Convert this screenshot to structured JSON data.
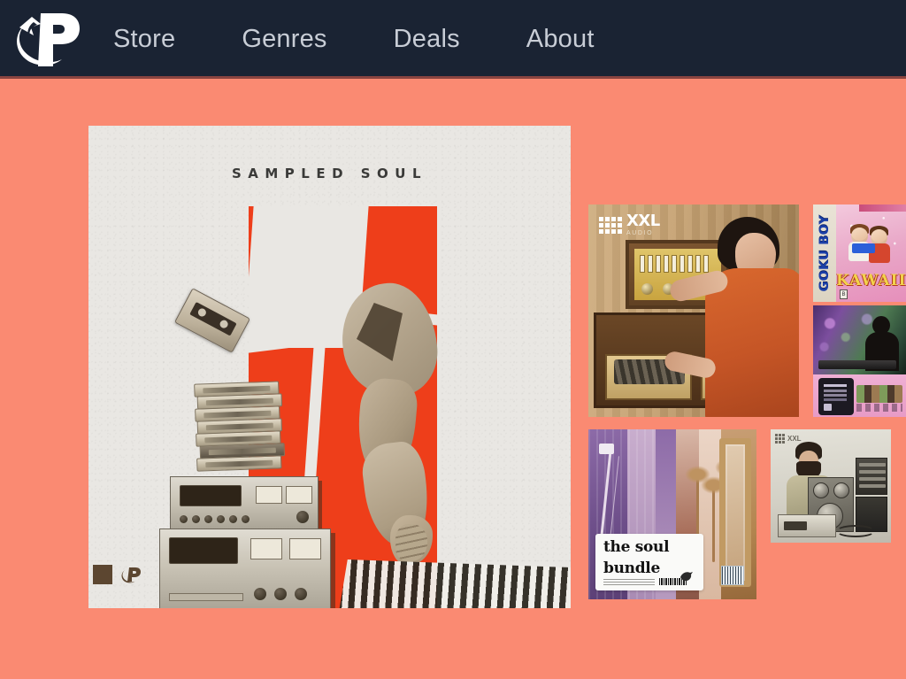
{
  "header": {
    "logo": {
      "icon": "swoosh-p-logo",
      "alt": "P"
    },
    "nav_items": [
      {
        "label": "Store"
      },
      {
        "label": "Genres"
      },
      {
        "label": "Deals"
      },
      {
        "label": "About"
      }
    ]
  },
  "hero": {
    "title": "SAMPLED SOUL",
    "footer_mark_icon": "swoosh-p-mark",
    "artwork_elements": [
      "red-fractured-panel",
      "sculpted-figure-holding-cassette",
      "stacked-cassette-tapes",
      "vintage-stereo-receiver",
      "vintage-cassette-deck",
      "striped-rug"
    ]
  },
  "gallery": {
    "items": [
      {
        "id": "xxl-audio",
        "name": "xxl-audio-ad",
        "brand": "XXL",
        "brand_sub": "AUDIO",
        "description": "Vintage hi-fi advertisement with woman and turntable console"
      },
      {
        "id": "goku-boy",
        "name": "goku-boy-cartridge",
        "spine_label": "GOKU BOY",
        "title": "KAWAII",
        "rating": "B",
        "description": "Handheld game cartridge box with two anime characters"
      },
      {
        "id": "synth-session",
        "name": "synth-session-photo",
        "description": "Silhouetted musician at keyboard with bokeh lights"
      },
      {
        "id": "soul-bundle",
        "name": "soul-bundle-cover",
        "title_line_1": "the soul",
        "title_line_2": "bundle",
        "description": "Purple and peach collage with palm trees and gilded frame"
      },
      {
        "id": "home-studio",
        "name": "home-studio-photo",
        "description": "Bearded man seated beside speakers, rack gear and tape deck"
      }
    ]
  },
  "theme": {
    "background": "#FA8A72",
    "header_bg": "#1A2333",
    "nav_text": "#C8CDD6",
    "album_bg": "#E9E7E3",
    "accent_red": "#EE3E1A",
    "title_text": "#3A3A38"
  }
}
